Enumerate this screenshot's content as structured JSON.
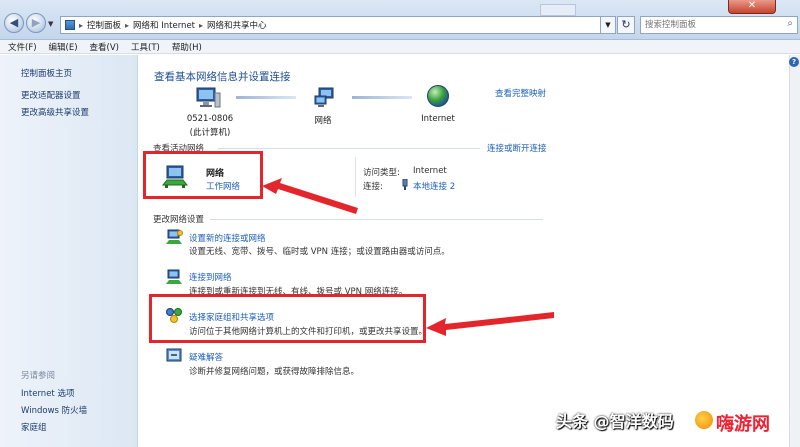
{
  "address": {
    "back_glyph": "◀",
    "forward_glyph": "▶",
    "crumbs": [
      "控制面板",
      "网络和 Internet",
      "网络和共享中心"
    ],
    "crumb_sep": "▸",
    "refresh_glyph": "↻",
    "search_placeholder": "搜索控制面板",
    "close_glyph": "✕"
  },
  "menu": [
    "文件(F)",
    "编辑(E)",
    "查看(V)",
    "工具(T)",
    "帮助(H)"
  ],
  "left_pane": {
    "links": [
      "控制面板主页",
      "更改适配器设置",
      "更改高级共享设置"
    ],
    "see_also_title": "另请参阅",
    "see_also": [
      "Internet 选项",
      "Windows 防火墙",
      "家庭组"
    ]
  },
  "main": {
    "heading": "查看基本网络信息并设置连接",
    "full_map_link": "查看完整映射",
    "map": {
      "pc_name": "0521-0806",
      "pc_sub": "(此计算机)",
      "network": "网络",
      "internet": "Internet"
    },
    "active_section_label": "查看活动网络",
    "connect_disconnect_link": "连接或断开连接",
    "active_network": {
      "name": "网络",
      "type": "工作网络",
      "access_type_label": "访问类型:",
      "access_type_value": "Internet",
      "connection_label": "连接:",
      "connection_value": "本地连接 2"
    },
    "change_section_label": "更改网络设置",
    "tasks": [
      {
        "title": "设置新的连接或网络",
        "desc": "设置无线、宽带、拨号、临时或 VPN 连接；或设置路由器或访问点。"
      },
      {
        "title": "连接到网络",
        "desc": "连接到或重新连接到无线、有线、拨号或 VPN 网络连接。"
      },
      {
        "title": "选择家庭组和共享选项",
        "desc": "访问位于其他网络计算机上的文件和打印机，或更改共享设置。"
      },
      {
        "title": "疑难解答",
        "desc": "诊断并修复网络问题，或获得故障排除信息。"
      }
    ]
  },
  "help_glyph": "?",
  "watermark": {
    "text": "头条 @智洋数码",
    "brand": "嗨游网"
  },
  "colors": {
    "annotation_red": "#e3262c",
    "link_blue": "#1d5fb6",
    "heading_blue": "#1e4e90"
  }
}
